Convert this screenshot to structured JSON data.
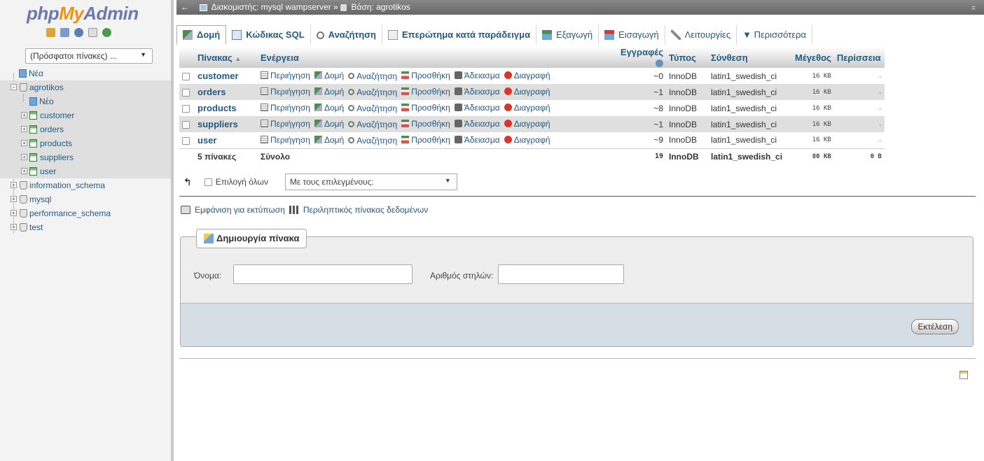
{
  "nav": {
    "logo": {
      "php": "php",
      "my": "My",
      "admin": "Admin"
    },
    "recent_tables": "(Πρόσφατοι πίνακες) ...",
    "tree": {
      "new": "Νέα",
      "db_active": "agrotikos",
      "db_new": "Νέο",
      "tables": [
        "customer",
        "orders",
        "products",
        "suppliers",
        "user"
      ],
      "other_dbs": [
        "information_schema",
        "mysql",
        "performance_schema",
        "test"
      ]
    }
  },
  "topbar": {
    "back": "←",
    "server_label": "Διακομιστής: mysql wampserver",
    "separator": "»",
    "db_label": "Βάση: agrotikos",
    "collapse": "⌅"
  },
  "tabs": [
    {
      "label": "Δομή"
    },
    {
      "label": "Κώδικας SQL"
    },
    {
      "label": "Αναζήτηση"
    },
    {
      "label": "Επερώτημα κατά παράδειγμα"
    },
    {
      "label": "Εξαγωγή"
    },
    {
      "label": "Εισαγωγή"
    },
    {
      "label": "Λειτουργίες"
    },
    {
      "label": "▼ Περισσότερα"
    }
  ],
  "table": {
    "headers": {
      "table": "Πίνακας",
      "action": "Ενέργεια",
      "rows": "Εγγραφές",
      "type": "Τύπος",
      "collation": "Σύνθεση",
      "size": "Μέγεθος",
      "overhead": "Περίσσεια"
    },
    "actions": {
      "browse": "Περιήγηση",
      "structure": "Δομή",
      "search": "Αναζήτηση",
      "insert": "Προσθήκη",
      "empty": "Άδειασμα",
      "drop": "Διαγραφή"
    },
    "rows": [
      {
        "name": "customer",
        "rows": "~0",
        "type": "InnoDB",
        "collation": "latin1_swedish_ci",
        "size": "16 KB",
        "overhead": "-"
      },
      {
        "name": "orders",
        "rows": "~1",
        "type": "InnoDB",
        "collation": "latin1_swedish_ci",
        "size": "16 KB",
        "overhead": "-"
      },
      {
        "name": "products",
        "rows": "~8",
        "type": "InnoDB",
        "collation": "latin1_swedish_ci",
        "size": "16 KB",
        "overhead": "-"
      },
      {
        "name": "suppliers",
        "rows": "~1",
        "type": "InnoDB",
        "collation": "latin1_swedish_ci",
        "size": "16 KB",
        "overhead": "-"
      },
      {
        "name": "user",
        "rows": "~9",
        "type": "InnoDB",
        "collation": "latin1_swedish_ci",
        "size": "16 KB",
        "overhead": "-"
      }
    ],
    "footer": {
      "count": "5 πίνακες",
      "total": "Σύνολο",
      "rows": "19",
      "type": "InnoDB",
      "collation": "latin1_swedish_ci",
      "size": "80 KB",
      "overhead": "0 B"
    }
  },
  "selection": {
    "check_all": "Επιλογή όλων",
    "with_selected": "Με τους επιλεγμένους:"
  },
  "links": {
    "print": "Εμφάνιση για εκτύπωση",
    "dictionary": "Περιληπτικός πίνακας δεδομένων"
  },
  "create": {
    "legend": "Δημιουργία πίνακα",
    "name_label": "Όνομα:",
    "columns_label": "Αριθμός στηλών:",
    "go": "Εκτέλεση"
  },
  "colors": {
    "link": "#235a81",
    "logo_blue": "#6c78af",
    "logo_orange": "#f29111"
  }
}
